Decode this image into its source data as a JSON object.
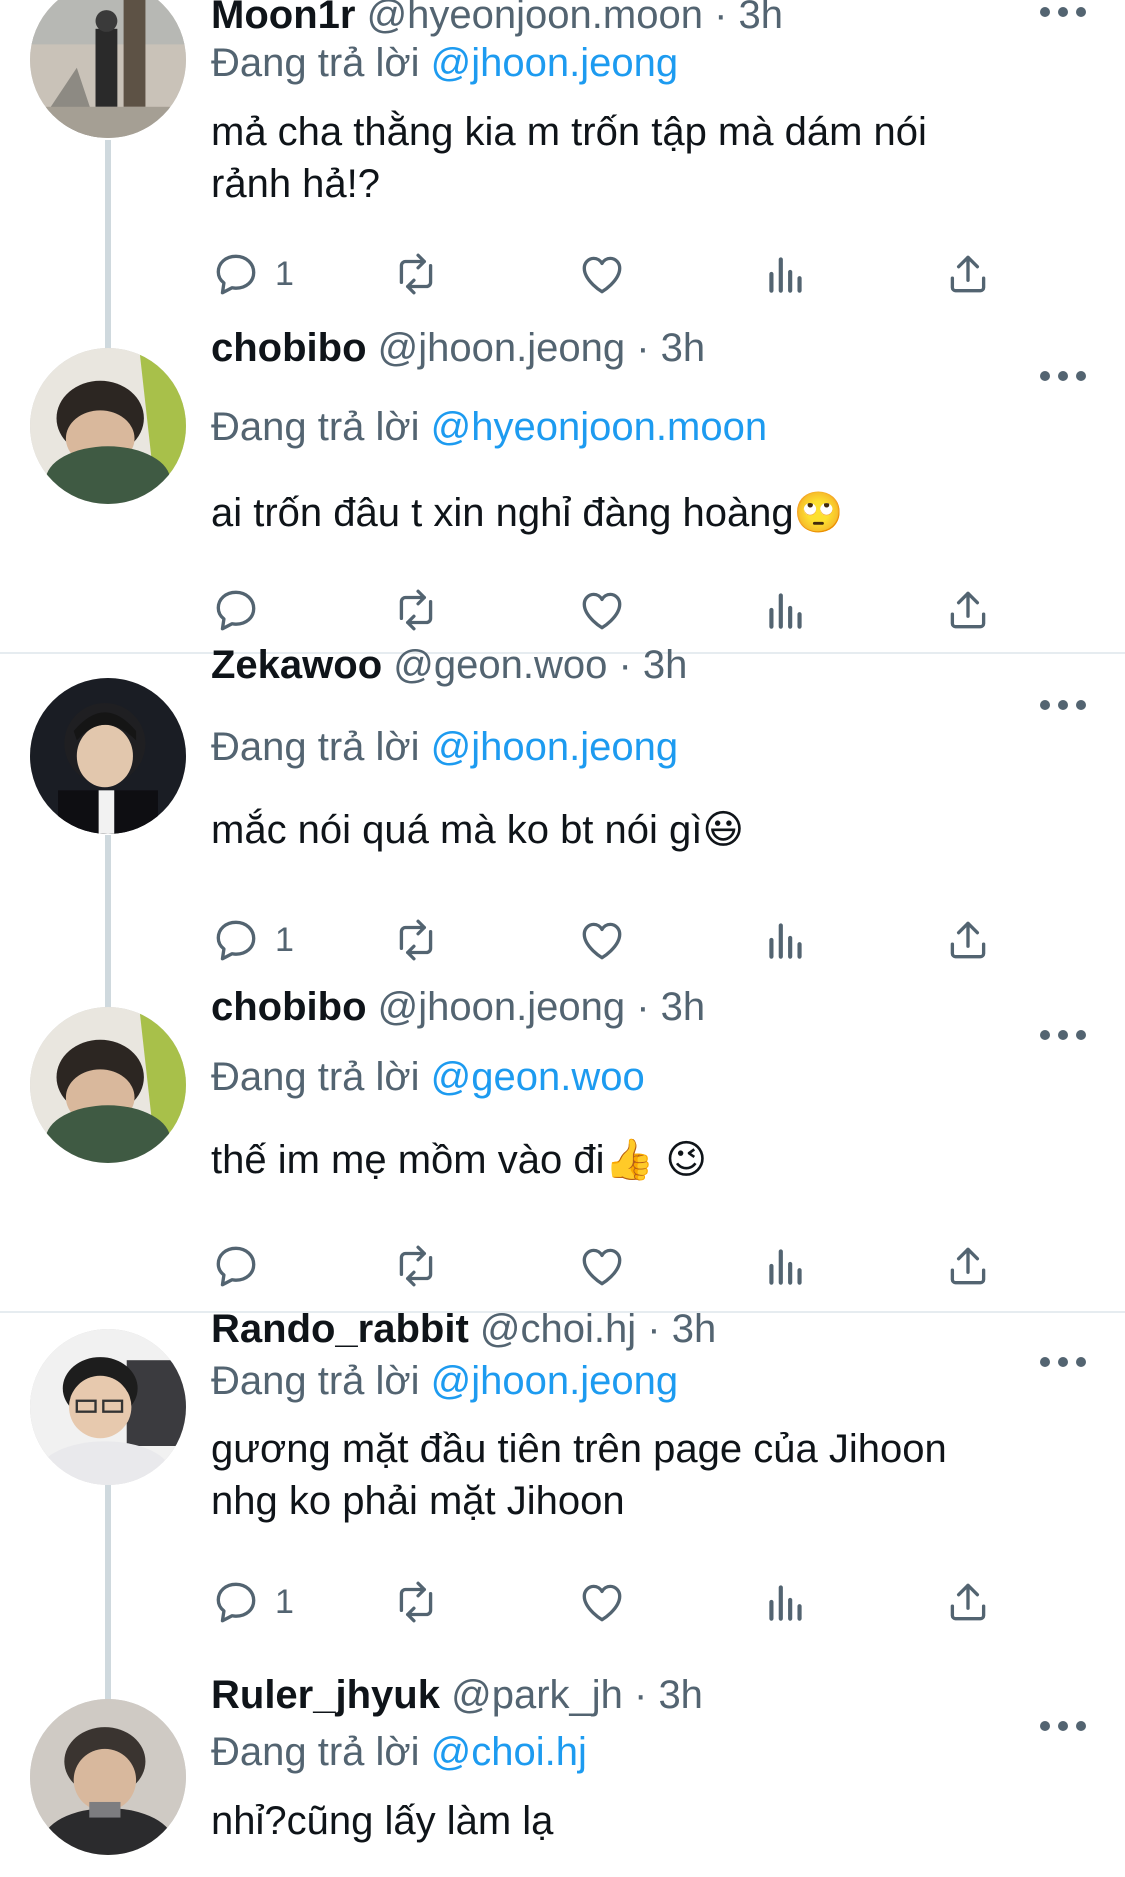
{
  "reply_prefix": "Đang trả lời",
  "tweets": [
    {
      "name": "Moon1r",
      "meta": "@hyeonjoon.moon · 3h",
      "reply_to": "@jhoon.jeong",
      "text_lines": [
        "mả cha thằng kia m trốn tập mà dám nói",
        "rảnh hả!?"
      ],
      "reply_count": "1",
      "avatar": "avatar-street-photo"
    },
    {
      "name": "chobibo",
      "meta": "@jhoon.jeong · 3h",
      "reply_to": "@hyeonjoon.moon",
      "text_lines": [
        "ai trốn đâu t xin nghỉ đàng hoàng🙄"
      ],
      "reply_count": "",
      "avatar": "avatar-boy-blanket"
    },
    {
      "name": "Zekawoo",
      "meta": "@geon.woo · 3h",
      "reply_to": "@jhoon.jeong",
      "text_lines": [
        "mắc nói quá mà ko bt nói gì😃"
      ],
      "reply_count": "1",
      "avatar": "avatar-boy-jacket"
    },
    {
      "name": "chobibo",
      "meta": "@jhoon.jeong · 3h",
      "reply_to": "@geon.woo",
      "text_lines": [
        "thế im mẹ mồm vào đi👍 😉"
      ],
      "reply_count": "",
      "avatar": "avatar-boy-blanket"
    },
    {
      "name": "Rando_rabbit",
      "meta": "@choi.hj · 3h",
      "reply_to": "@jhoon.jeong",
      "text_lines": [
        "gương mặt đầu tiên trên page của Jihoon",
        "nhg ko phải mặt Jihoon"
      ],
      "reply_count": "1",
      "avatar": "avatar-boy-glasses"
    },
    {
      "name": "Ruler_jhyuk",
      "meta": "@park_jh · 3h",
      "reply_to": "@choi.hj",
      "text_lines": [
        "nhỉ?cũng lấy làm lạ"
      ],
      "reply_count": "",
      "avatar": "avatar-boy-phone"
    }
  ],
  "colors": {
    "link": "#1d9bf0",
    "secondary": "#536471",
    "thread_line": "#cfd9de"
  },
  "icons": [
    "reply-icon",
    "retweet-icon",
    "like-icon",
    "views-icon",
    "share-icon",
    "more-icon"
  ]
}
